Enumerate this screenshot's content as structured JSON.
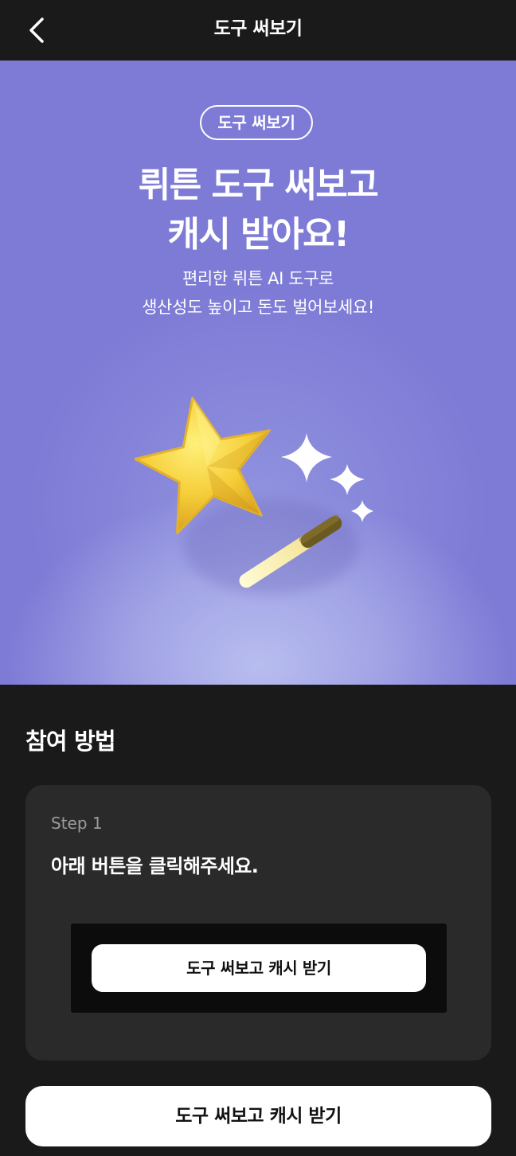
{
  "header": {
    "title": "도구 써보기",
    "back_icon": "chevron-left-icon"
  },
  "hero": {
    "pill": "도구 써보기",
    "title_line1": "뤼튼 도구 써보고",
    "title_line2": "캐시 받아요!",
    "subtitle_line1": "편리한 뤼튼 AI 도구로",
    "subtitle_line2": "생산성도 높이고 돈도 벌어보세요!",
    "illustration_icon": "magic-wand-star-icon",
    "background_color": "#7e7bd6"
  },
  "section": {
    "title": "참여 방법"
  },
  "step": {
    "label": "Step 1",
    "description": "아래 버튼을 클릭해주세요.",
    "preview_button_label": "도구 써보고 캐시 받기"
  },
  "cta": {
    "label": "도구 써보고 캐시 받기"
  }
}
